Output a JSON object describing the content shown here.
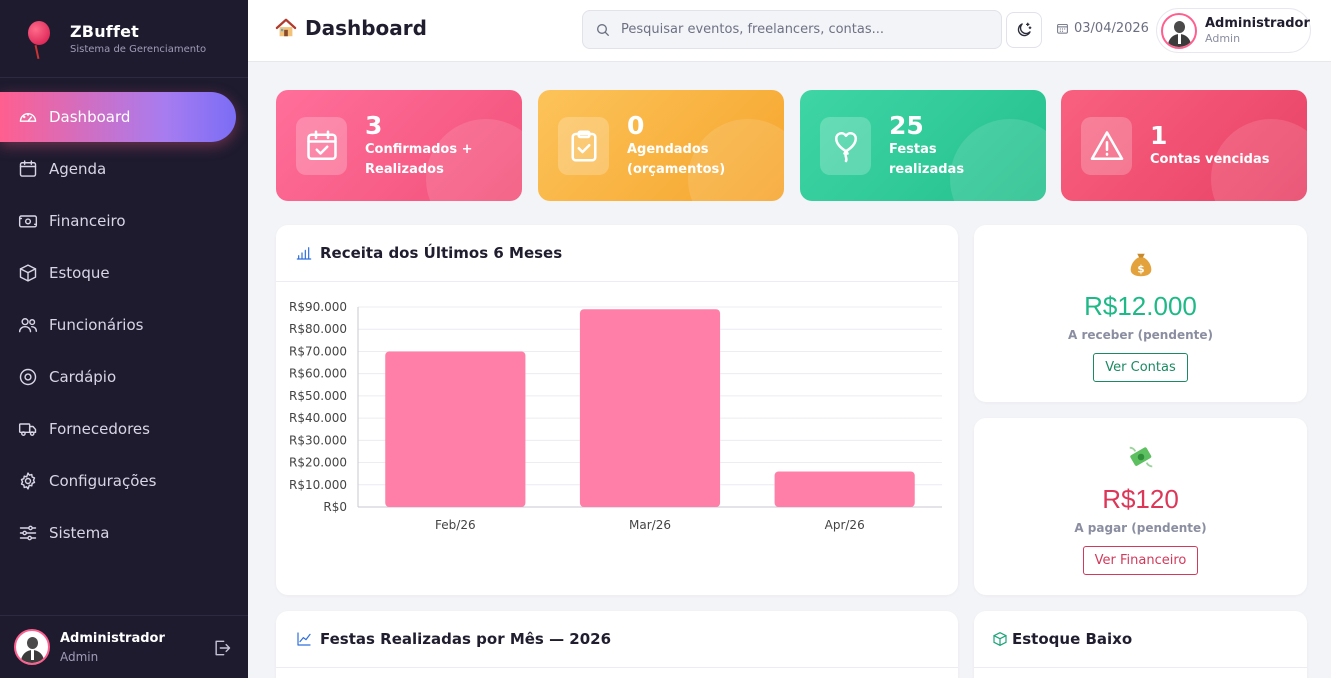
{
  "brand": {
    "name": "ZBuffet",
    "subtitle": "Sistema de Gerenciamento"
  },
  "sidebar": {
    "items": [
      {
        "label": "Dashboard",
        "icon": "gauge-icon",
        "active": true
      },
      {
        "label": "Agenda",
        "icon": "calendar-icon"
      },
      {
        "label": "Financeiro",
        "icon": "cash-icon"
      },
      {
        "label": "Estoque",
        "icon": "box-icon"
      },
      {
        "label": "Funcionários",
        "icon": "people-icon"
      },
      {
        "label": "Cardápio",
        "icon": "menu-icon"
      },
      {
        "label": "Fornecedores",
        "icon": "truck-icon"
      },
      {
        "label": "Configurações",
        "icon": "gear-icon"
      },
      {
        "label": "Sistema",
        "icon": "sliders-icon"
      }
    ],
    "user": {
      "name": "Administrador",
      "role": "Admin"
    }
  },
  "header": {
    "title": "Dashboard",
    "search_placeholder": "Pesquisar eventos, freelancers, contas...",
    "date": "03/04/2026",
    "user": {
      "name": "Administrador",
      "role": "Admin"
    }
  },
  "stats": [
    {
      "value": "3",
      "label": "Confirmados + Realizados",
      "icon": "calendar-check-icon",
      "color": "#f85a85"
    },
    {
      "value": "0",
      "label": "Agendados (orçamentos)",
      "icon": "clipboard-check-icon",
      "color": "#f9b03e"
    },
    {
      "value": "25",
      "label": "Festas realizadas",
      "icon": "balloon-icon",
      "color": "#2fcb98"
    },
    {
      "value": "1",
      "label": "Contas vencidas",
      "icon": "warning-icon",
      "color": "#f04f72"
    }
  ],
  "revenue_panel": {
    "title": "Receita dos Últimos 6 Meses"
  },
  "chart_data": {
    "type": "bar",
    "categories": [
      "Feb/26",
      "Mar/26",
      "Apr/26"
    ],
    "values": [
      70000,
      89000,
      16000
    ],
    "ylim": [
      0,
      90000
    ],
    "yticks": [
      "R$0",
      "R$10.000",
      "R$20.000",
      "R$30.000",
      "R$40.000",
      "R$50.000",
      "R$60.000",
      "R$70.000",
      "R$80.000",
      "R$90.000"
    ],
    "bar_color": "#ff7fa8",
    "grid": true,
    "title": "",
    "xlabel": "",
    "ylabel": ""
  },
  "receivable": {
    "amount": "R$12.000",
    "label": "A receber (pendente)",
    "button": "Ver Contas",
    "color": "#1fb987"
  },
  "payable": {
    "amount": "R$120",
    "label": "A pagar (pendente)",
    "button": "Ver Financeiro",
    "color": "#dc3759"
  },
  "parties_panel": {
    "title": "Festas Realizadas por Mês — 2026"
  },
  "stock_panel": {
    "title": "Estoque Baixo"
  }
}
